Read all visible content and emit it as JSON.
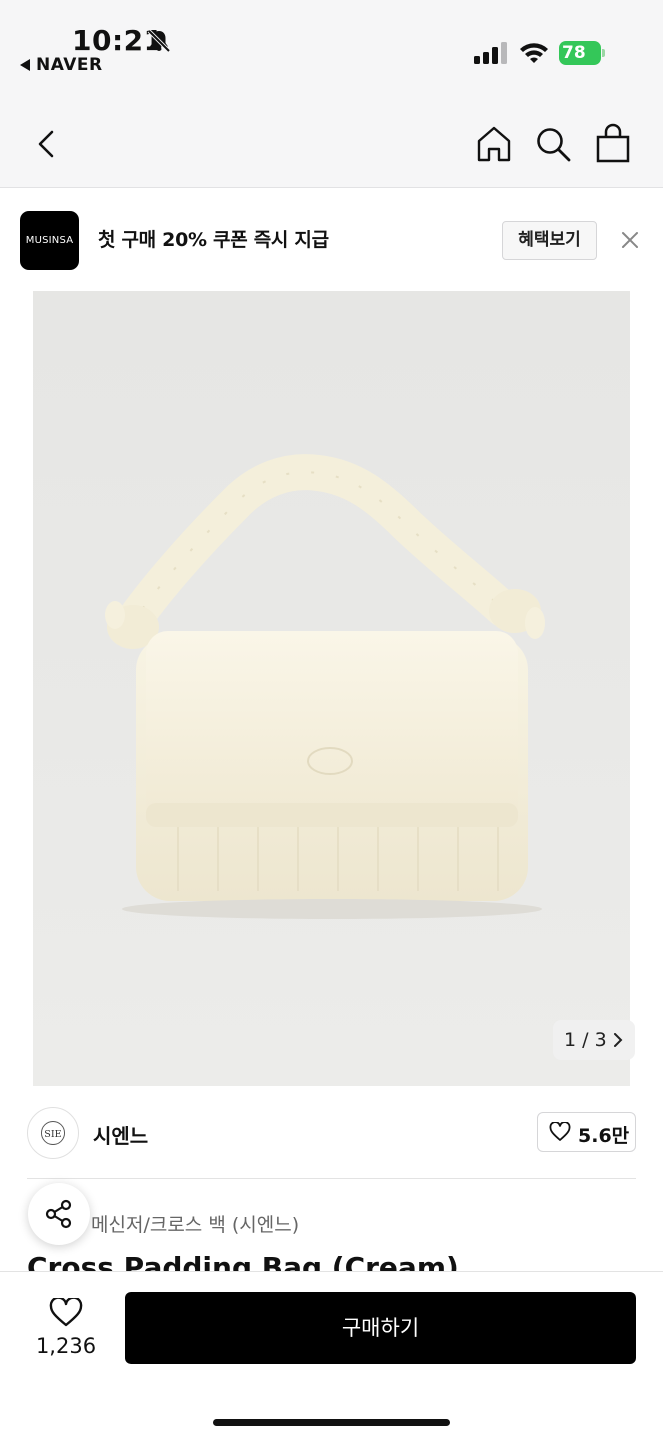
{
  "status_bar": {
    "time": "10:21",
    "back_app": "NAVER",
    "battery": "78"
  },
  "nav": {
    "icons": [
      "chevron-left-icon",
      "home-icon",
      "search-icon",
      "shopping-bag-icon"
    ]
  },
  "promo": {
    "logo_text": "MUSINSA",
    "text": "첫 구매 20% 쿠폰 즉시 지급",
    "button_label": "혜택보기"
  },
  "gallery": {
    "counter": "1 / 3"
  },
  "brand": {
    "name": "시엔느",
    "logo_text": "SIE",
    "likes": "5.6만"
  },
  "product": {
    "category": "메신저/크로스 백 (시엔느)",
    "title": "Cross Padding Bag (Cream)"
  },
  "bottom_bar": {
    "wish_count": "1,236",
    "buy_label": "구매하기"
  },
  "colors": {
    "battery": "#34c759",
    "buy_button": "#000000",
    "product_bg": "#e8e8e6",
    "bag": "#f6f1de"
  }
}
